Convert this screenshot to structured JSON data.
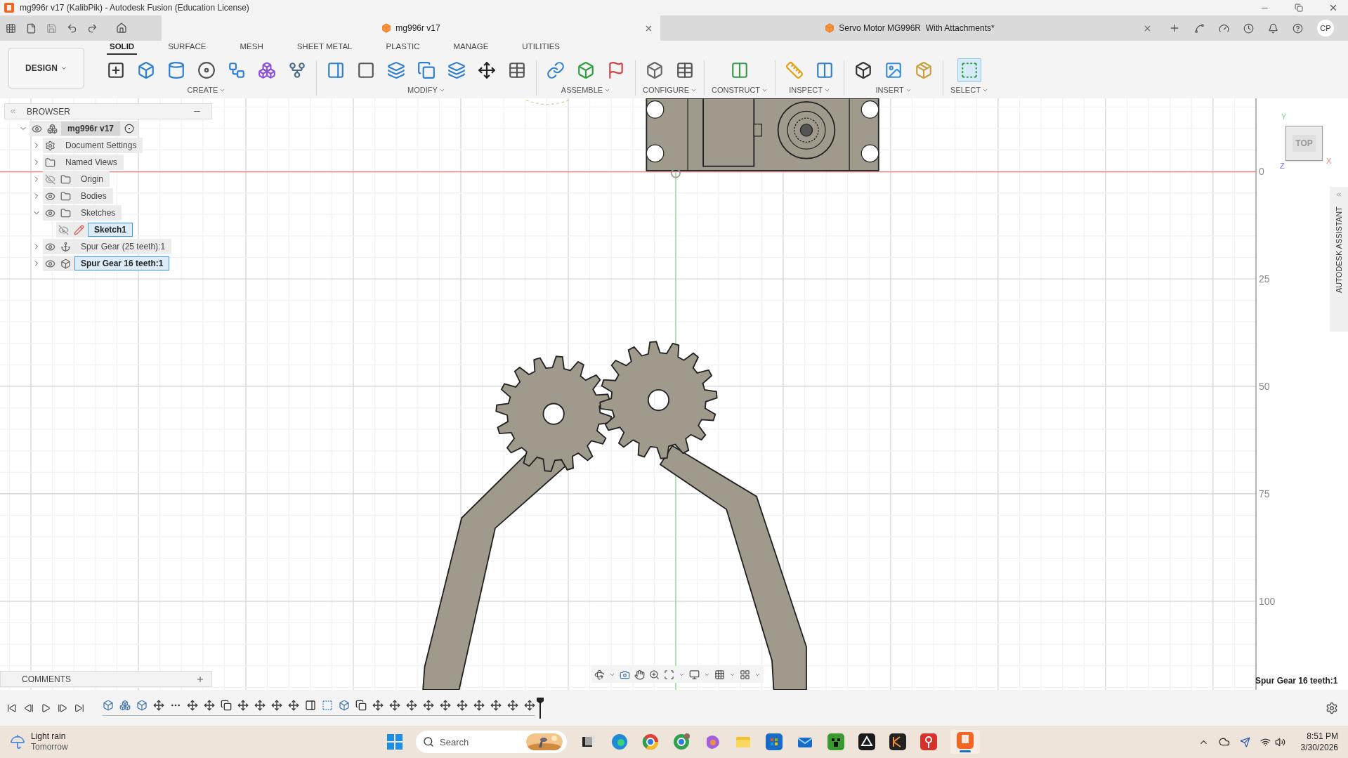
{
  "window": {
    "title": "mg996r v17 (KalibPik) - Autodesk Fusion (Education License)"
  },
  "document_tabs": [
    {
      "label": "mg996r v17",
      "selected": true
    },
    {
      "label": "Servo Motor MG996R  With Attachments*",
      "selected": false
    }
  ],
  "user": {
    "initials": "CP"
  },
  "workspace": {
    "label": "DESIGN"
  },
  "toolbar_tabs": [
    {
      "label": "SOLID",
      "selected": true
    },
    {
      "label": "SURFACE",
      "selected": false
    },
    {
      "label": "MESH",
      "selected": false
    },
    {
      "label": "SHEET METAL",
      "selected": false
    },
    {
      "label": "PLASTIC",
      "selected": false
    },
    {
      "label": "MANAGE",
      "selected": false
    },
    {
      "label": "UTILITIES",
      "selected": false
    }
  ],
  "tool_groups": [
    {
      "label": "CREATE"
    },
    {
      "label": "MODIFY"
    },
    {
      "label": "ASSEMBLE"
    },
    {
      "label": "CONFIGURE"
    },
    {
      "label": "CONSTRUCT"
    },
    {
      "label": "INSPECT"
    },
    {
      "label": "INSERT"
    },
    {
      "label": "SELECT"
    }
  ],
  "browser": {
    "title": "BROWSER",
    "tree": [
      {
        "label": "mg996r v17",
        "kind": "root",
        "visible": true,
        "expanded": true,
        "selected": false,
        "children": [
          {
            "label": "Document Settings",
            "kind": "settings",
            "expanded": false,
            "selected": false
          },
          {
            "label": "Named Views",
            "kind": "folder",
            "expanded": false,
            "selected": false
          },
          {
            "label": "Origin",
            "kind": "folder",
            "visible": false,
            "expanded": false,
            "selected": false
          },
          {
            "label": "Bodies",
            "kind": "folder",
            "visible": true,
            "expanded": false,
            "selected": false
          },
          {
            "label": "Sketches",
            "kind": "folder",
            "visible": true,
            "expanded": true,
            "selected": false,
            "children": [
              {
                "label": "Sketch1",
                "kind": "sketch",
                "visible": false,
                "selected": true
              }
            ]
          },
          {
            "label": "Spur Gear (25 teeth):1",
            "kind": "linked",
            "visible": true,
            "expanded": false,
            "selected": false
          },
          {
            "label": "Spur Gear 16 teeth:1",
            "kind": "component",
            "visible": true,
            "expanded": false,
            "selected": true
          }
        ]
      }
    ]
  },
  "viewport": {
    "ruler_labels": [
      "0",
      "25",
      "50",
      "75",
      "100"
    ],
    "view_cube": {
      "face": "TOP",
      "axes": [
        "Y",
        "X",
        "Z"
      ]
    },
    "assistant": {
      "label": "AUTODESK ASSISTANT"
    },
    "selection_label": "Spur Gear 16 teeth:1"
  },
  "comments": {
    "title": "COMMENTS"
  },
  "taskbar": {
    "weather": {
      "title": "Light rain",
      "subtitle": "Tomorrow"
    },
    "search": {
      "placeholder": "Search"
    },
    "clock": {
      "time": "8:51 PM",
      "date": "3/30/2026"
    }
  }
}
